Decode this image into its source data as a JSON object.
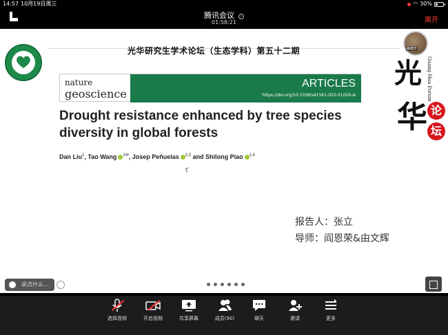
{
  "status_bar": {
    "time": "14:57",
    "date": "10月19日周三",
    "battery": "30%"
  },
  "header": {
    "title": "腾讯会议",
    "timer": "01:58:21",
    "leave": "离开"
  },
  "slide": {
    "forum_title": "光华研究生学术论坛（生态学科）第五十二期",
    "journal": {
      "name_top": "nature",
      "name_bottom": "geoscience",
      "section": "ARTICLES",
      "doi": "https://doi.org/10.1038/s41561-022-01026-w"
    },
    "paper_title": "Drought resistance enhanced by tree species diversity in global forests",
    "authors": [
      {
        "name": "Dan Liu",
        "sup": "1",
        "orcid": false
      },
      {
        "name": "Tao Wang",
        "sup": "1✉",
        "orcid": true
      },
      {
        "name": "Josep Peñuelas",
        "sup": "2,3",
        "orcid": true
      },
      {
        "name": "Shilong Piao",
        "sup": "1,4",
        "orcid": true
      }
    ],
    "reporter": "报告人：张立",
    "advisor": "导师：阎恩荣&由文辉",
    "forum_en": "Guang Hua Forum",
    "callig_1": "光",
    "callig_2": "华",
    "seal_1": "论",
    "seal_2": "坛",
    "avatar_name": "薛建华",
    "comment_placeholder": "说点什么...",
    "page_dots": 6
  },
  "toolbar": [
    {
      "label": "选择音频",
      "icon": "mic-muted-icon"
    },
    {
      "label": "开启视频",
      "icon": "video-off-icon"
    },
    {
      "label": "共享屏幕",
      "icon": "share-screen-icon"
    },
    {
      "label": "成员(90)",
      "icon": "members-icon"
    },
    {
      "label": "聊天",
      "icon": "chat-icon"
    },
    {
      "label": "邀请",
      "icon": "invite-icon"
    },
    {
      "label": "更多",
      "icon": "more-icon"
    }
  ],
  "colors": {
    "accent_red": "#ff3b30",
    "journal_green": "#1a7a4a",
    "toolbar_bg": "#1c1c1e"
  }
}
